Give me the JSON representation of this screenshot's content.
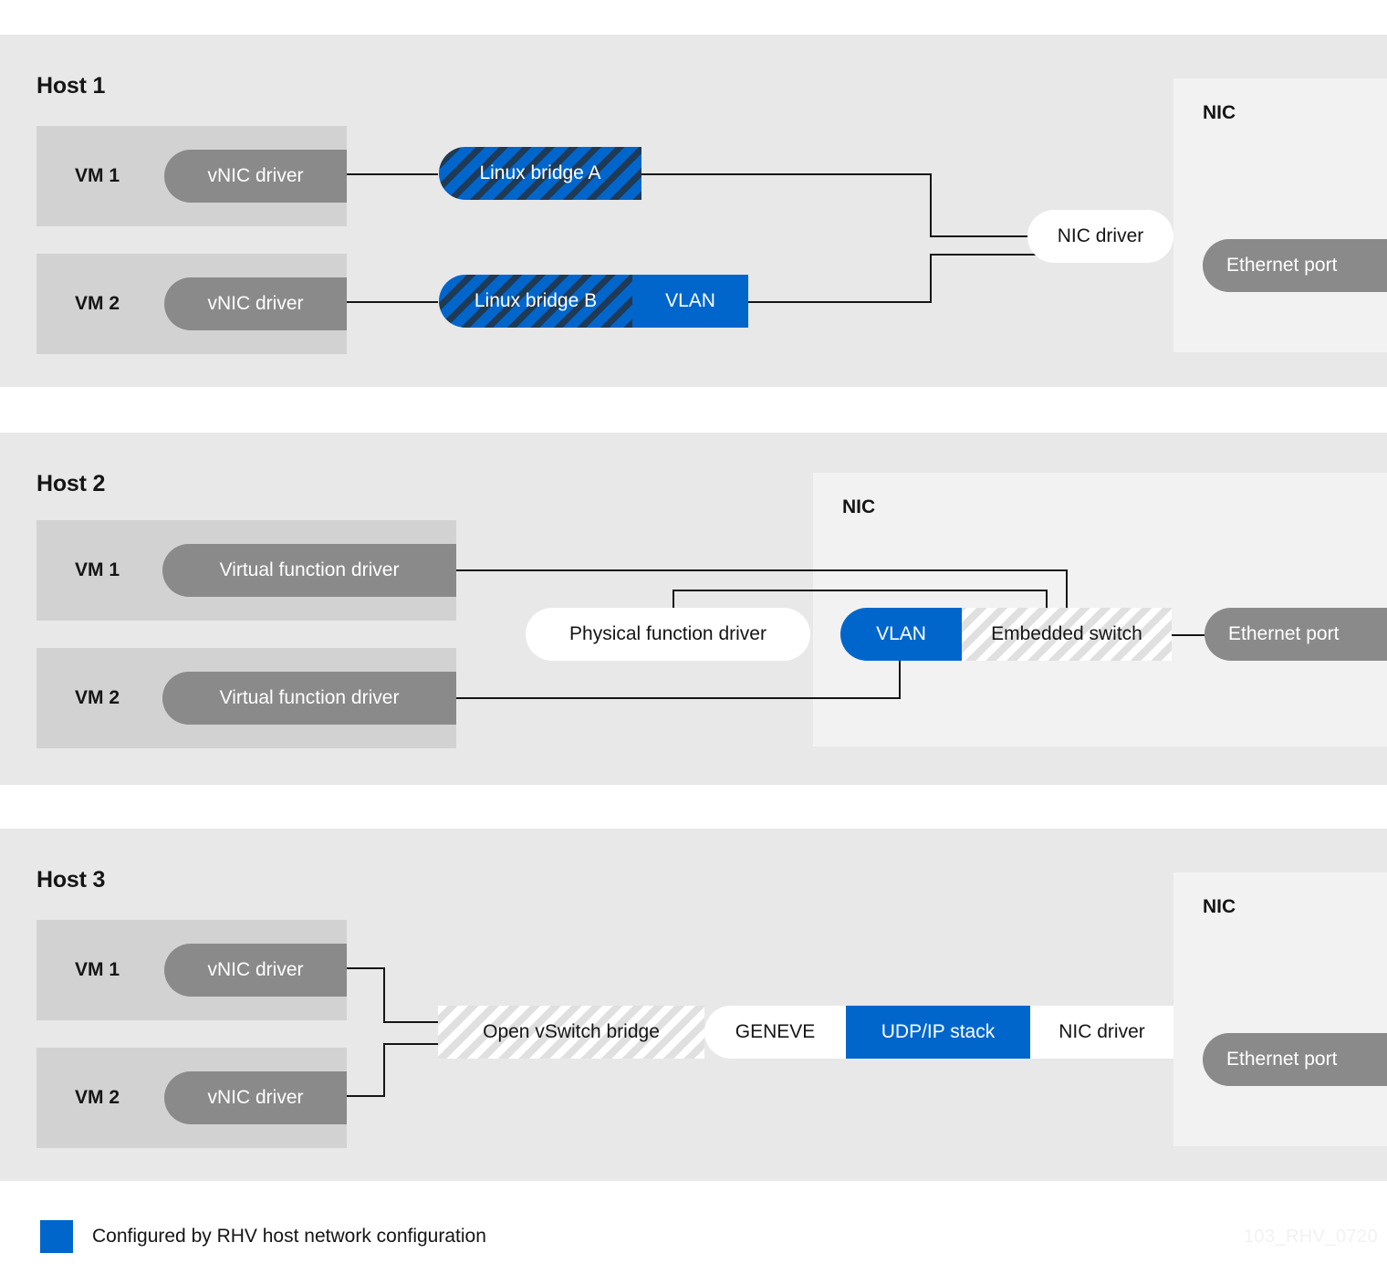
{
  "legend": {
    "label": "Configured by RHV host network configuration",
    "swatch_color": "#0066cc"
  },
  "watermark": "103_RHV_0720",
  "colors": {
    "accent_blue": "#0066cc",
    "host_panel_bg": "#e8e8e8",
    "vm_box_bg": "#d2d2d2",
    "driver_pill_bg": "#8a8a8a",
    "nic_panel_bg": "#f2f2f2",
    "wire": "#151515",
    "chip_white": "#ffffff"
  },
  "hosts": [
    {
      "title": "Host 1",
      "nic_title": "NIC",
      "ethernet_port": "Ethernet port",
      "vms": [
        {
          "label": "VM 1",
          "driver": "vNIC driver"
        },
        {
          "label": "VM 2",
          "driver": "vNIC driver"
        }
      ],
      "chips": [
        {
          "label": "Linux bridge A",
          "style": "blue-hatch"
        },
        {
          "label": "Linux bridge B",
          "style": "blue-hatch"
        },
        {
          "label": "VLAN",
          "style": "blue"
        },
        {
          "label": "NIC driver",
          "style": "white"
        }
      ]
    },
    {
      "title": "Host 2",
      "nic_title": "NIC",
      "ethernet_port": "Ethernet port",
      "vms": [
        {
          "label": "VM 1",
          "driver": "Virtual function driver"
        },
        {
          "label": "VM 2",
          "driver": "Virtual function driver"
        }
      ],
      "chips": [
        {
          "label": "Physical function driver",
          "style": "white"
        },
        {
          "label": "VLAN",
          "style": "blue"
        },
        {
          "label": "Embedded switch",
          "style": "light-hatch"
        }
      ]
    },
    {
      "title": "Host 3",
      "nic_title": "NIC",
      "ethernet_port": "Ethernet port",
      "vms": [
        {
          "label": "VM 1",
          "driver": "vNIC driver"
        },
        {
          "label": "VM 2",
          "driver": "vNIC driver"
        }
      ],
      "chips": [
        {
          "label": "Open vSwitch bridge",
          "style": "light-hatch"
        },
        {
          "label": "GENEVE",
          "style": "white"
        },
        {
          "label": "UDP/IP stack",
          "style": "blue"
        },
        {
          "label": "NIC driver",
          "style": "white"
        }
      ]
    }
  ]
}
